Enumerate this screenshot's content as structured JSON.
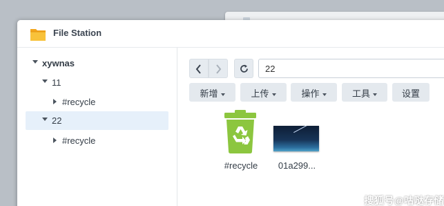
{
  "window": {
    "title": "File Station",
    "app_icon": "folder-icon"
  },
  "sidebar": {
    "items": [
      {
        "label": "xywnas",
        "expanded": true
      },
      {
        "label": "11",
        "expanded": true
      },
      {
        "label": "#recycle",
        "expanded": false
      },
      {
        "label": "22",
        "expanded": true,
        "selected": true
      },
      {
        "label": "#recycle",
        "expanded": false
      }
    ]
  },
  "toolbar": {
    "back_icon": "chevron-left-icon",
    "forward_icon": "chevron-right-icon",
    "refresh_icon": "refresh-icon",
    "path": "22",
    "buttons": [
      {
        "label": "新增",
        "has_menu": true
      },
      {
        "label": "上传",
        "has_menu": true
      },
      {
        "label": "操作",
        "has_menu": true
      },
      {
        "label": "工具",
        "has_menu": true
      },
      {
        "label": "设置",
        "has_menu": false
      }
    ]
  },
  "files": [
    {
      "name": "#recycle",
      "icon": "recycle-bin-icon"
    },
    {
      "name": "01a299...",
      "icon": "image-thumbnail"
    }
  ],
  "watermark": "搜狐号@咕哒存储",
  "colors": {
    "selection": "#e6f0fa",
    "recycle_green": "#8cc63f",
    "toolbar_button": "#e4e9ee"
  }
}
